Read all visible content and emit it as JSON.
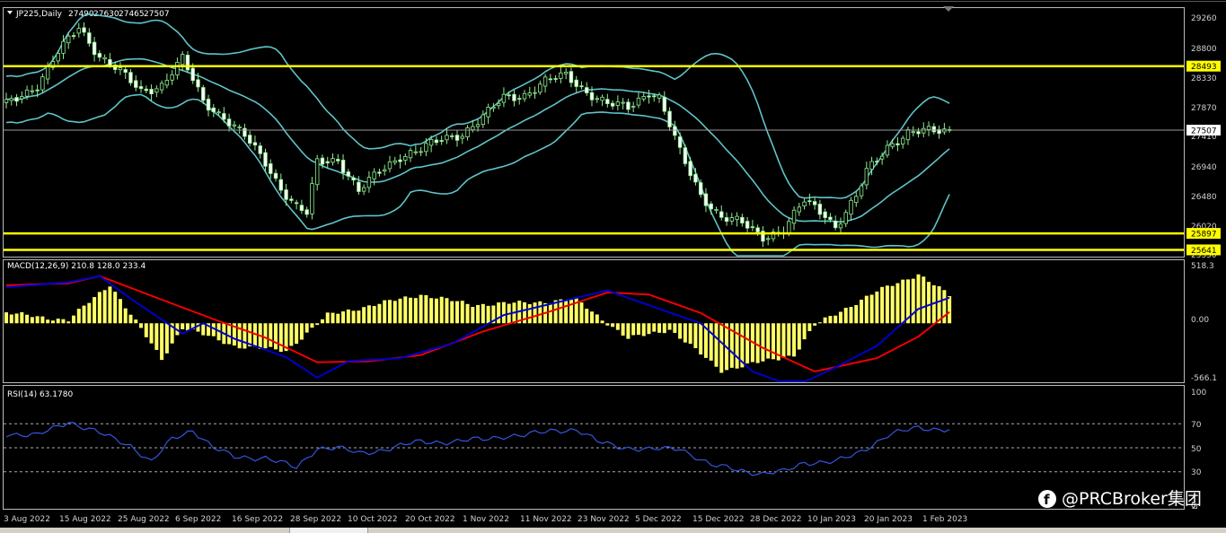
{
  "chart_data": [
    {
      "type": "candlestick",
      "title": "JP225,Daily",
      "ohlc_readout": [
        "27490",
        "27630",
        "27465",
        "27507"
      ],
      "y_ticks": [
        "29260",
        "28800",
        "28330",
        "27870",
        "27410",
        "26940",
        "26480",
        "26020",
        "25550"
      ],
      "ylim": [
        25550,
        29380
      ],
      "current_price": "27507",
      "levels": [
        {
          "label": "28493",
          "value": 28493
        },
        {
          "label": "25897",
          "value": 25897
        },
        {
          "label": "25641",
          "value": 25641
        }
      ],
      "indicator": "Bollinger Bands",
      "x_ticks": [
        "3 Aug 2022",
        "15 Aug 2022",
        "25 Aug 2022",
        "6 Sep 2022",
        "16 Sep 2022",
        "28 Sep 2022",
        "10 Oct 2022",
        "20 Oct 2022",
        "1 Nov 2022",
        "11 Nov 2022",
        "23 Nov 2022",
        "5 Dec 2022",
        "15 Dec 2022",
        "28 Dec 2022",
        "10 Jan 2023",
        "20 Jan 2023",
        "1 Feb 2023"
      ],
      "close_anchors": [
        [
          0,
          27900
        ],
        [
          6,
          28200
        ],
        [
          10,
          28700
        ],
        [
          14,
          29100
        ],
        [
          18,
          28650
        ],
        [
          22,
          28400
        ],
        [
          26,
          28100
        ],
        [
          30,
          28200
        ],
        [
          34,
          28600
        ],
        [
          38,
          27950
        ],
        [
          42,
          27700
        ],
        [
          46,
          27400
        ],
        [
          50,
          27000
        ],
        [
          53,
          26600
        ],
        [
          56,
          26300
        ],
        [
          58,
          26200
        ],
        [
          60,
          27000
        ],
        [
          64,
          27050
        ],
        [
          68,
          26550
        ],
        [
          72,
          26850
        ],
        [
          76,
          27100
        ],
        [
          80,
          27200
        ],
        [
          84,
          27350
        ],
        [
          88,
          27450
        ],
        [
          92,
          27700
        ],
        [
          96,
          28000
        ],
        [
          100,
          28050
        ],
        [
          104,
          28250
        ],
        [
          108,
          28350
        ],
        [
          112,
          28100
        ],
        [
          116,
          27900
        ],
        [
          120,
          27850
        ],
        [
          124,
          28100
        ],
        [
          126,
          28000
        ],
        [
          130,
          27150
        ],
        [
          134,
          26500
        ],
        [
          138,
          26150
        ],
        [
          142,
          26050
        ],
        [
          146,
          25850
        ],
        [
          150,
          25950
        ],
        [
          154,
          26400
        ],
        [
          158,
          26200
        ],
        [
          160,
          26000
        ],
        [
          164,
          26450
        ],
        [
          166,
          26850
        ],
        [
          170,
          27250
        ],
        [
          174,
          27450
        ],
        [
          178,
          27480
        ],
        [
          182,
          27507
        ]
      ]
    },
    {
      "type": "macd",
      "title": "MACD(12,26,9) 210.8 128.0 233.4",
      "y_ticks": [
        "518.3",
        "0.00",
        "-566.1"
      ],
      "ylim": [
        -566.1,
        518.3
      ],
      "hist_anchors": [
        [
          0,
          100
        ],
        [
          12,
          30
        ],
        [
          20,
          380
        ],
        [
          30,
          -350
        ],
        [
          34,
          -40
        ],
        [
          44,
          -220
        ],
        [
          54,
          -270
        ],
        [
          62,
          80
        ],
        [
          80,
          280
        ],
        [
          90,
          180
        ],
        [
          100,
          200
        ],
        [
          110,
          230
        ],
        [
          120,
          -150
        ],
        [
          128,
          -60
        ],
        [
          138,
          -460
        ],
        [
          152,
          -310
        ],
        [
          156,
          -20
        ],
        [
          168,
          310
        ],
        [
          176,
          480
        ],
        [
          182,
          270
        ]
      ],
      "signal_anchors": [
        [
          0,
          370
        ],
        [
          12,
          390
        ],
        [
          18,
          460
        ],
        [
          30,
          230
        ],
        [
          40,
          40
        ],
        [
          50,
          -140
        ],
        [
          60,
          -380
        ],
        [
          70,
          -370
        ],
        [
          80,
          -310
        ],
        [
          92,
          -80
        ],
        [
          104,
          100
        ],
        [
          116,
          300
        ],
        [
          124,
          280
        ],
        [
          134,
          100
        ],
        [
          146,
          -240
        ],
        [
          156,
          -470
        ],
        [
          168,
          -340
        ],
        [
          176,
          -130
        ],
        [
          182,
          110
        ]
      ],
      "line_anchors": [
        [
          0,
          350
        ],
        [
          12,
          400
        ],
        [
          18,
          460
        ],
        [
          24,
          240
        ],
        [
          34,
          -100
        ],
        [
          38,
          0
        ],
        [
          44,
          -150
        ],
        [
          54,
          -330
        ],
        [
          60,
          -530
        ],
        [
          66,
          -370
        ],
        [
          76,
          -340
        ],
        [
          86,
          -200
        ],
        [
          96,
          80
        ],
        [
          106,
          200
        ],
        [
          116,
          320
        ],
        [
          126,
          140
        ],
        [
          134,
          0
        ],
        [
          144,
          -470
        ],
        [
          152,
          -620
        ],
        [
          160,
          -430
        ],
        [
          168,
          -220
        ],
        [
          176,
          140
        ],
        [
          182,
          250
        ]
      ]
    },
    {
      "type": "line",
      "title": "RSI(14) 63.1780",
      "y_ticks": [
        "100",
        "70",
        "50",
        "30",
        "0"
      ],
      "ylim": [
        0,
        100
      ],
      "levels": [
        70,
        50,
        30
      ],
      "rsi_anchors": [
        [
          0,
          62
        ],
        [
          6,
          60
        ],
        [
          12,
          72
        ],
        [
          18,
          62
        ],
        [
          24,
          52
        ],
        [
          28,
          38
        ],
        [
          32,
          57
        ],
        [
          36,
          65
        ],
        [
          40,
          50
        ],
        [
          44,
          42
        ],
        [
          50,
          42
        ],
        [
          56,
          33
        ],
        [
          60,
          50
        ],
        [
          64,
          50
        ],
        [
          68,
          45
        ],
        [
          72,
          48
        ],
        [
          80,
          55
        ],
        [
          86,
          55
        ],
        [
          92,
          57
        ],
        [
          96,
          60
        ],
        [
          100,
          60
        ],
        [
          106,
          65
        ],
        [
          110,
          65
        ],
        [
          114,
          55
        ],
        [
          120,
          50
        ],
        [
          124,
          48
        ],
        [
          130,
          50
        ],
        [
          136,
          35
        ],
        [
          140,
          33
        ],
        [
          146,
          28
        ],
        [
          150,
          30
        ],
        [
          154,
          38
        ],
        [
          160,
          38
        ],
        [
          164,
          45
        ],
        [
          170,
          60
        ],
        [
          176,
          67
        ],
        [
          182,
          65
        ]
      ]
    }
  ],
  "watermark": "@PRCBroker集团",
  "colors": {
    "candle": "#90ee90",
    "band": "#5fc3c8",
    "level": "#ffff00",
    "hist": "#ffff66",
    "macd_line": "#0000cc",
    "signal": "#ee0000",
    "rsi": "#3355dd",
    "grid": "#bbbbbb"
  }
}
